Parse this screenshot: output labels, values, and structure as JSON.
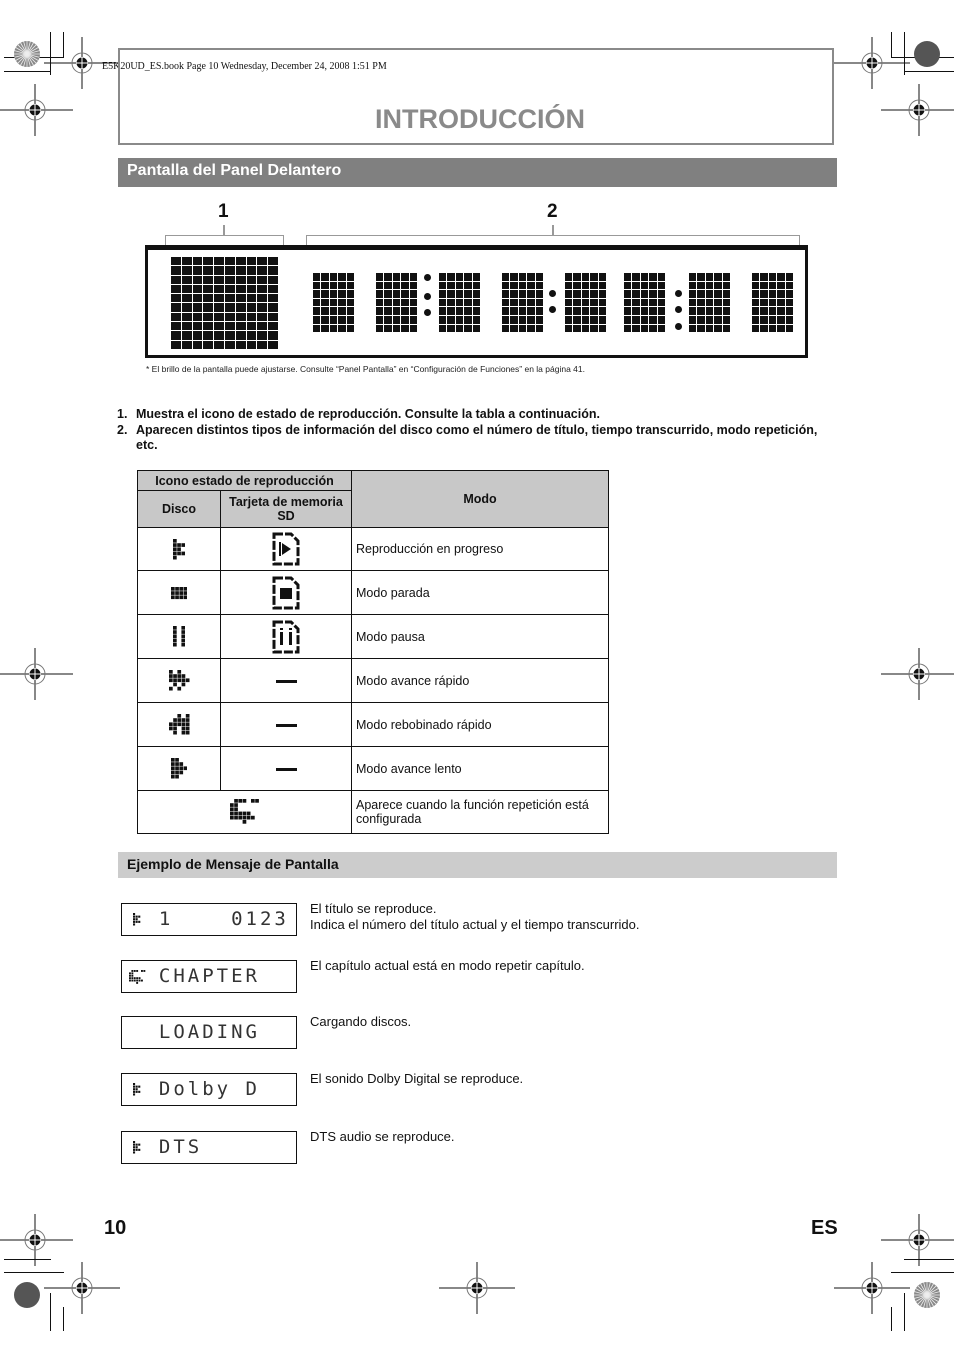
{
  "book_info": "E5K20UD_ES.book  Page 10  Wednesday, December 24, 2008  1:51 PM",
  "page_title": "INTRODUCCIÓN",
  "section": {
    "title": "Pantalla del Panel Delantero",
    "callouts": [
      "1",
      "2"
    ],
    "footnote": "* El brillo de la pantalla puede ajustarse. Consulte “Panel Pantalla” en “Configuración de Funciones” en la página 41."
  },
  "numbered_list": [
    {
      "num": "1.",
      "text": "Muestra el icono de estado de reproducción. Consulte la tabla a continuación."
    },
    {
      "num": "2.",
      "text": "Aparecen distintos tipos de información del disco como el número de título, tiempo transcurrido, modo repetición, etc."
    }
  ],
  "table": {
    "header_group": "Icono estado de reproducción",
    "col_disc": "Disco",
    "col_sd": "Tarjeta de memoria SD",
    "col_mode": "Modo",
    "rows": [
      {
        "disc_icon": "play-icon",
        "sd_icon": "sd-play-icon",
        "mode": "Reproducción en progreso"
      },
      {
        "disc_icon": "stop-icon",
        "sd_icon": "sd-stop-icon",
        "mode": "Modo parada"
      },
      {
        "disc_icon": "pause-icon",
        "sd_icon": "sd-pause-icon",
        "mode": "Modo pausa"
      },
      {
        "disc_icon": "fast-forward-icon",
        "sd_icon": "dash",
        "mode": "Modo avance rápido"
      },
      {
        "disc_icon": "rewind-icon",
        "sd_icon": "dash",
        "mode": "Modo rebobinado rápido"
      },
      {
        "disc_icon": "slow-forward-icon",
        "sd_icon": "dash",
        "mode": "Modo avance lento"
      },
      {
        "disc_icon": "repeat-icon",
        "sd_icon": null,
        "mode": "Aparece cuando la función repetición está configurada"
      }
    ]
  },
  "examples": {
    "title": "Ejemplo de Mensaje de Pantalla",
    "items": [
      {
        "display": "  1    0123",
        "has_play_icon": true,
        "has_repeat_icon": false,
        "desc_lines": [
          "El título se reproduce.",
          "Indica el número del título actual y el tiempo transcurrido."
        ]
      },
      {
        "display": "  CHAPTER",
        "has_play_icon": false,
        "has_repeat_icon": true,
        "desc_lines": [
          "El capítulo actual está en modo repetir capítulo."
        ]
      },
      {
        "display": "  LOADING",
        "has_play_icon": false,
        "has_repeat_icon": false,
        "desc_lines": [
          "Cargando discos."
        ]
      },
      {
        "display": "  Dolby D",
        "has_play_icon": true,
        "has_repeat_icon": false,
        "desc_lines": [
          "El sonido Dolby Digital se reproduce."
        ]
      },
      {
        "display": "  DTS",
        "has_play_icon": true,
        "has_repeat_icon": false,
        "desc_lines": [
          "DTS audio se reproduce."
        ]
      }
    ]
  },
  "footer": {
    "page_number": "10",
    "language": "ES"
  }
}
